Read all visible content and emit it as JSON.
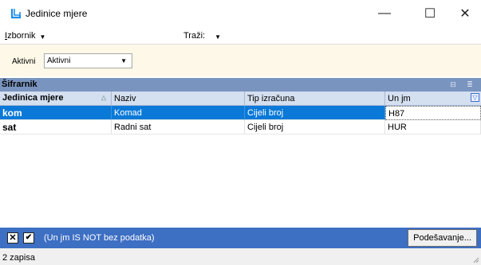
{
  "window": {
    "title": "Jedinice mjere",
    "minimize": "—",
    "maximize": "☐",
    "close": "✕"
  },
  "menu": {
    "izbornik_first": "I",
    "izbornik_rest": "zbornik",
    "trazi": "Traži:",
    "caret": "▼"
  },
  "filter": {
    "label": "Aktivni",
    "value": "Aktivni",
    "arrow": "▼"
  },
  "grid": {
    "title": "Šifrarnik",
    "tool1": "⊟",
    "tool2": "≣",
    "sort_glyph": "△",
    "filter_glyph": "▽",
    "columns": [
      "Jedinica mjere",
      "Naziv",
      "Tip izračuna",
      "Un jm"
    ],
    "rows": [
      [
        "kom",
        "Komad",
        "Cijeli broj",
        "H87"
      ],
      [
        "sat",
        "Radni sat",
        "Cijeli broj",
        "HUR"
      ]
    ],
    "selected_row": 0
  },
  "footer": {
    "x_glyph": "✕",
    "check_glyph": "✔",
    "filter_text": "(Un jm IS NOT bez podatka)",
    "button": "Podešavanje..."
  },
  "status": {
    "text": "2 zapisa"
  },
  "colors": {
    "accent": "#3d6fc3",
    "selection": "#0a79d8",
    "grid_header": "#7994bf",
    "filter_bg": "#fdf8e7",
    "icon_blue": "#1e8ee8"
  }
}
